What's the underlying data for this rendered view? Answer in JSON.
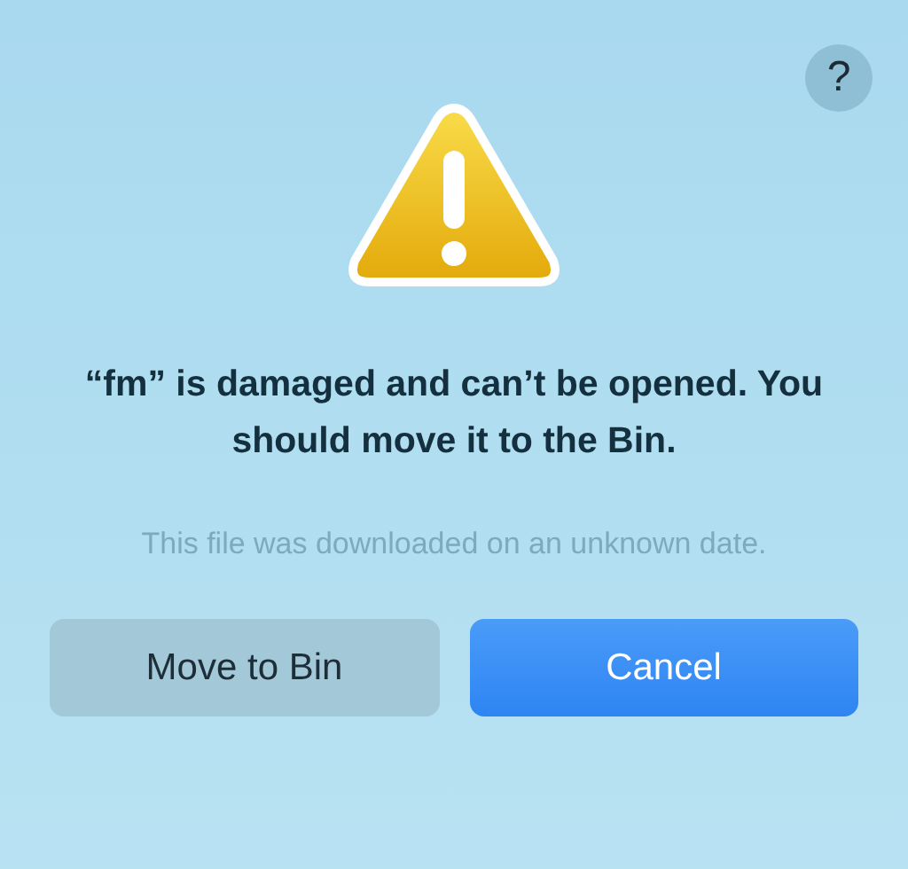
{
  "help_button": "?",
  "title": "“fm” is damaged and can’t be opened. You should move it to the Bin.",
  "message": "This file was downloaded on an unknown date.",
  "buttons": [
    {
      "label": "Move to Bin",
      "kind": "normal"
    },
    {
      "label": "Cancel",
      "kind": "default"
    }
  ]
}
